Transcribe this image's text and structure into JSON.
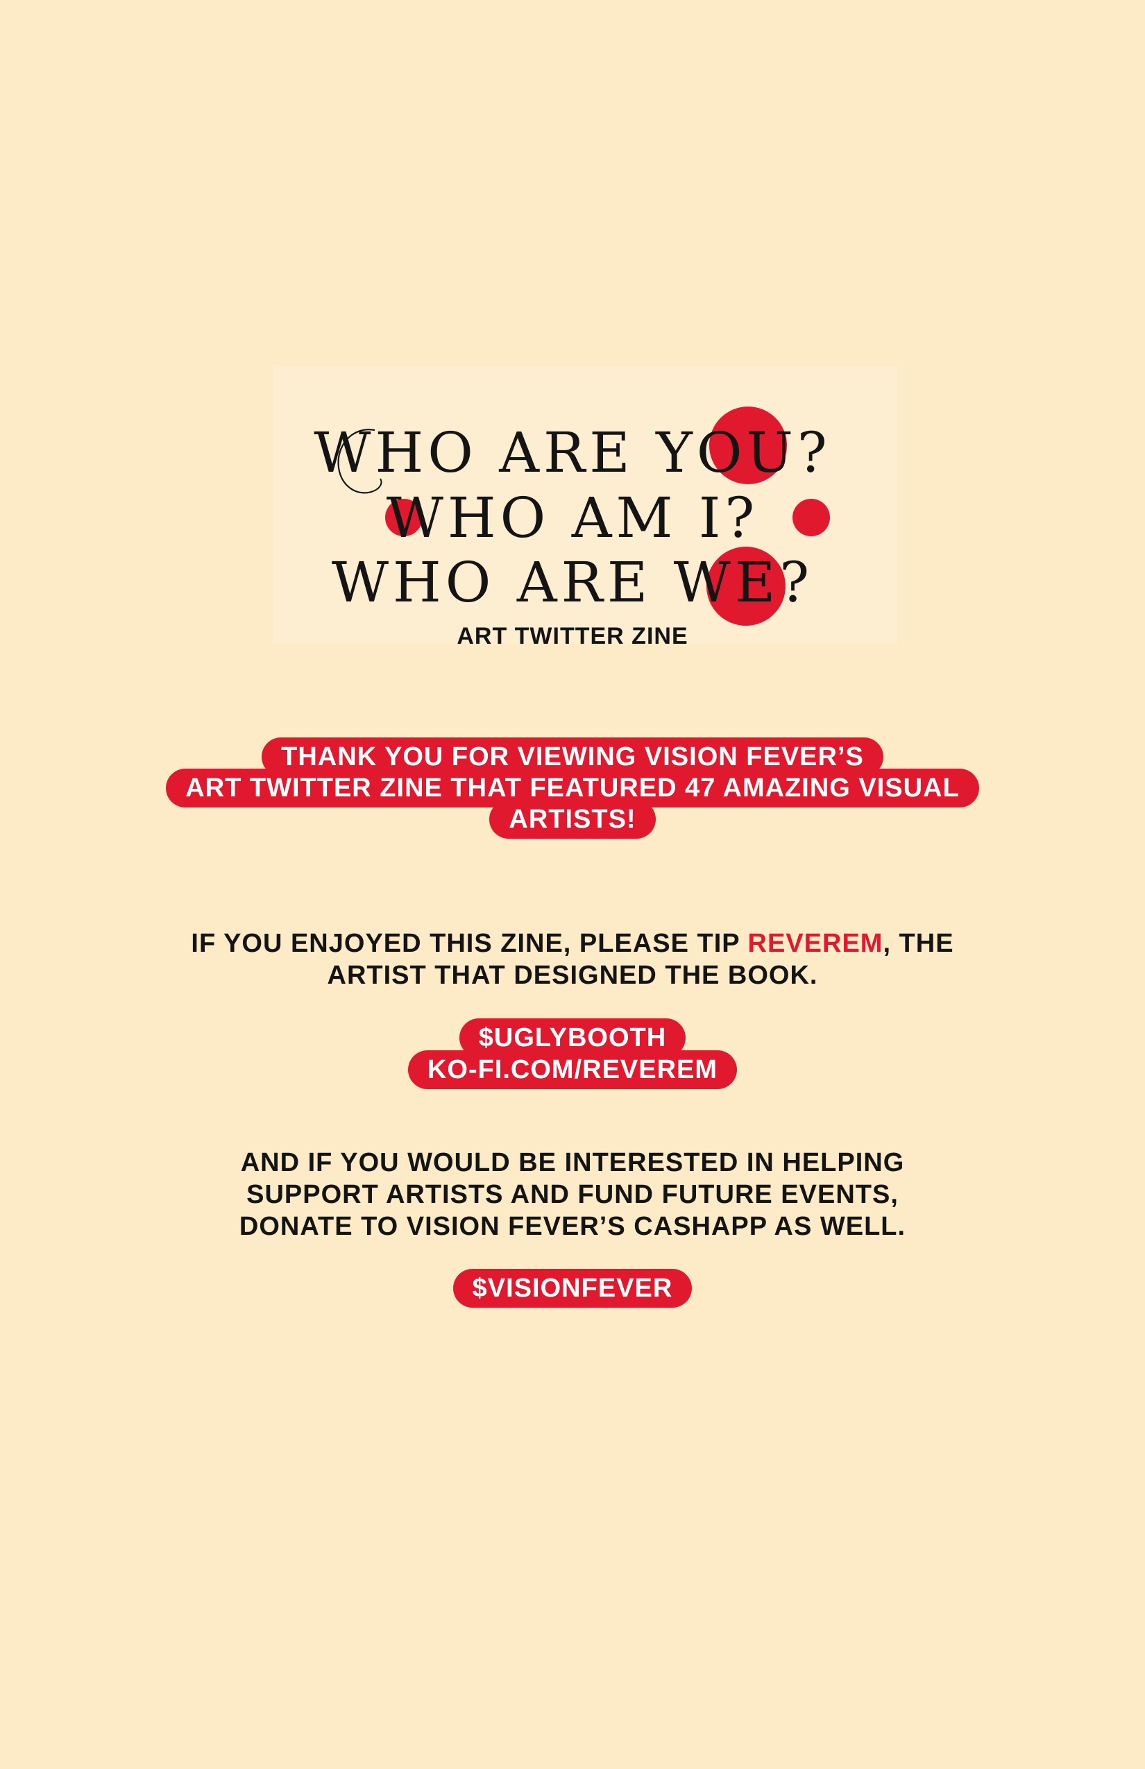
{
  "colors": {
    "background": "#fdebc8",
    "accent": "#e0192f",
    "text": "#141414"
  },
  "title": {
    "line1": "WHO ARE YOU?",
    "line2": "WHO AM I?",
    "line3": "WHO ARE WE?",
    "subtitle": "ART TWITTER ZINE"
  },
  "thanks": {
    "line1": "THANK YOU FOR VIEWING VISION FEVER’S",
    "line2": "ART TWITTER ZINE THAT FEATURED 47 AMAZING VISUAL",
    "line3": "ARTISTS!"
  },
  "tip": {
    "line1_before": "IF YOU ENJOYED THIS ZINE, PLEASE TIP ",
    "artist_name": "REVEREM",
    "line1_after": ", THE",
    "line2": "ARTIST THAT DESIGNED THE BOOK.",
    "cashtag": "$UGLYBOOTH",
    "kofi": "KO-FI.COM/REVEREM"
  },
  "donate": {
    "line1": "AND IF YOU WOULD BE INTERESTED IN HELPING",
    "line2": "SUPPORT ARTISTS AND FUND FUTURE EVENTS,",
    "line3": "DONATE TO VISION FEVER’S CASHAPP AS WELL.",
    "cashtag": "$VISIONFEVER"
  }
}
